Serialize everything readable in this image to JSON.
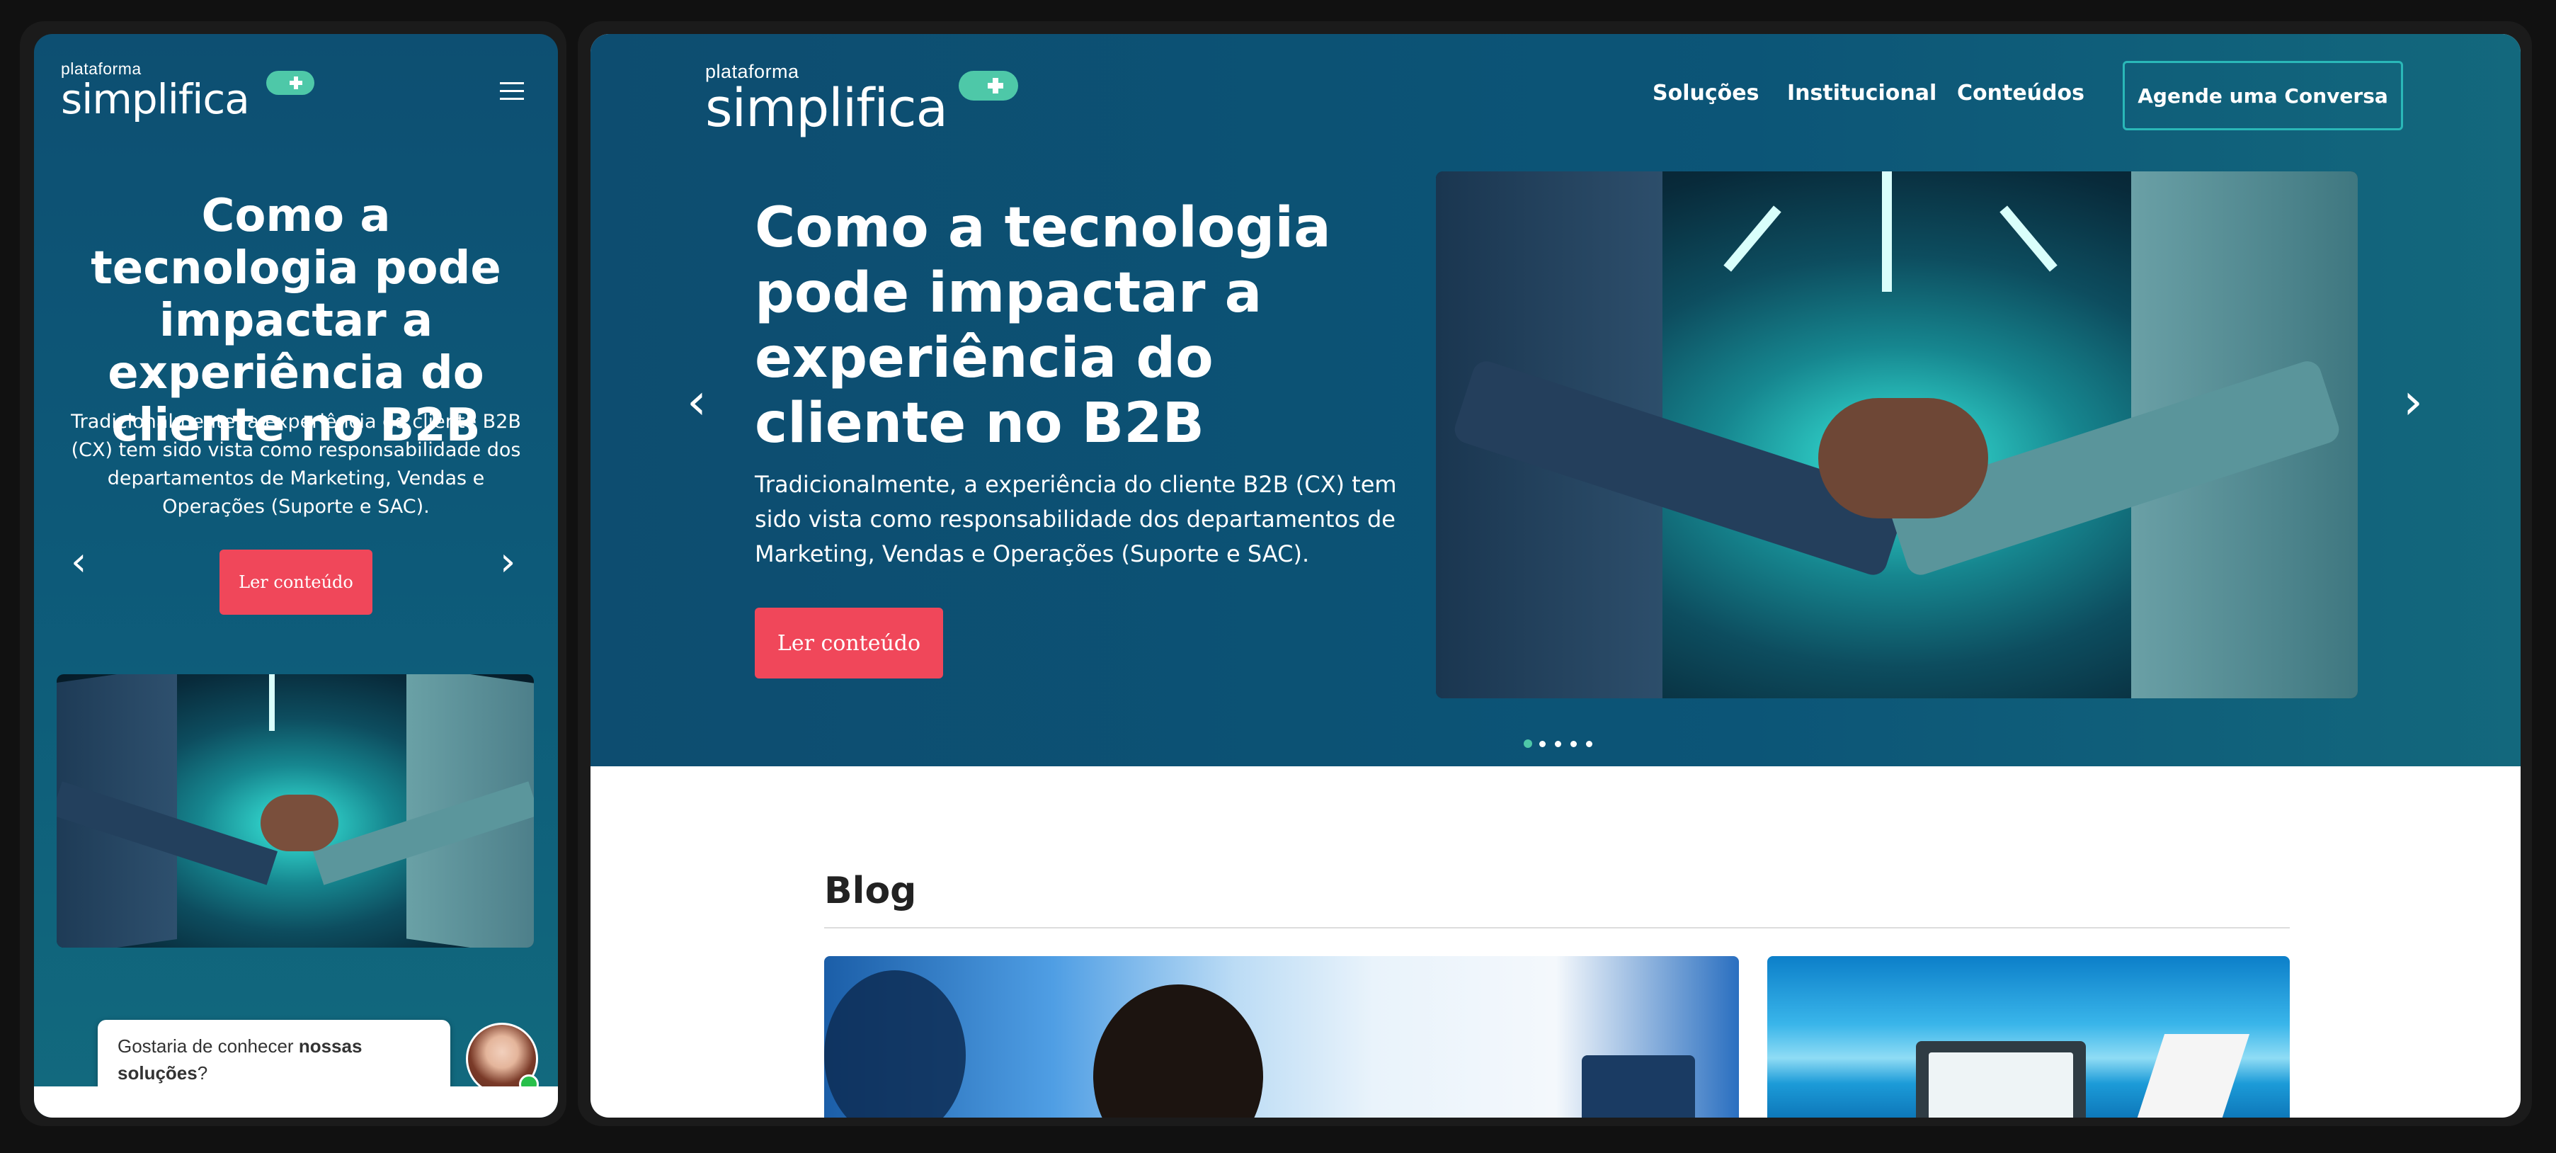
{
  "brand": {
    "small": "plataforma",
    "big": "simplifica"
  },
  "nav": {
    "items": [
      "Soluções",
      "Institucional",
      "Conteúdos"
    ],
    "cta": "Agende uma Conversa"
  },
  "hero": {
    "title_desktop": "Como a tecnologia pode impactar a experiência do cliente no B2B",
    "title_mobile": "Como a tecnologia pode impactar a experiência do cliente no B2B",
    "text_desktop": "Tradicionalmente, a experiência do cliente B2B (CX) tem sido vista como responsabilidade dos departamentos de Marketing, Vendas e Operações (Suporte e SAC).",
    "text_mobile": "Tradicionalmente, a experiência do cliente B2B (CX) tem sido vista como responsabilidade dos departamentos de Marketing, Vendas e Operações (Suporte e SAC).",
    "button": "Ler conteúdo",
    "prev_icon": "‹",
    "next_icon": "›",
    "dots": 5,
    "active_dot": 1
  },
  "blog": {
    "title": "Blog"
  },
  "chat": {
    "text_plain": "Gostaria de conhecer ",
    "text_bold": "nossas soluções",
    "text_end": "?"
  },
  "colors": {
    "hero_bg": "#0d5577",
    "accent_red": "#f0475a",
    "accent_green": "#4ec8a8",
    "cta_border": "#2ab8b8"
  },
  "icons": {
    "menu": "hamburger-menu-icon",
    "prev": "chevron-left-icon",
    "next": "chevron-right-icon"
  }
}
